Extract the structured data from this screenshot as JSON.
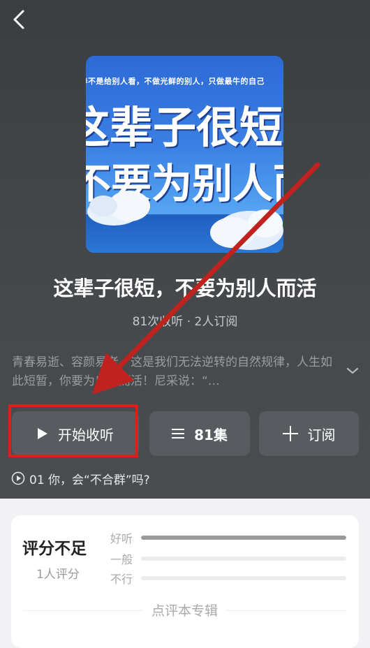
{
  "header": {
    "back_icon": "chevron-left-icon"
  },
  "album": {
    "cover_top_text": "青春不是给别人看，不做光鲜的别人，只做最牛的自己",
    "cover_line1": "这辈子很短",
    "cover_line2": "不要为别人而活",
    "title": "这辈子很短，不要为别人而活",
    "stats": "81次收听 · 2人订阅",
    "description": "青春易逝、容颜易老，这是我们无法逆转的自然规律，人生如此短暂，你要为自己而活！尼采说：“…"
  },
  "actions": {
    "play": {
      "label": "开始收听",
      "icon": "play-icon"
    },
    "episodes": {
      "label": "81集",
      "icon": "list-icon"
    },
    "subscribe": {
      "label": "订阅",
      "icon": "plus-icon"
    }
  },
  "current_episode": {
    "icon": "play-circle-icon",
    "label": "01 你，会“不合群”吗?"
  },
  "rating": {
    "title": "评分不足",
    "count": "1人评分",
    "rows": [
      {
        "label": "好听",
        "fraction": 1.0
      },
      {
        "label": "一般",
        "fraction": 0.0
      },
      {
        "label": "不行",
        "fraction": 0.0
      }
    ],
    "review_link": "点评本专辑"
  },
  "colors": {
    "background_top": "#45484b",
    "button": "#585b5f",
    "annotation_red": "#d7221c",
    "card": "#ffffff"
  }
}
